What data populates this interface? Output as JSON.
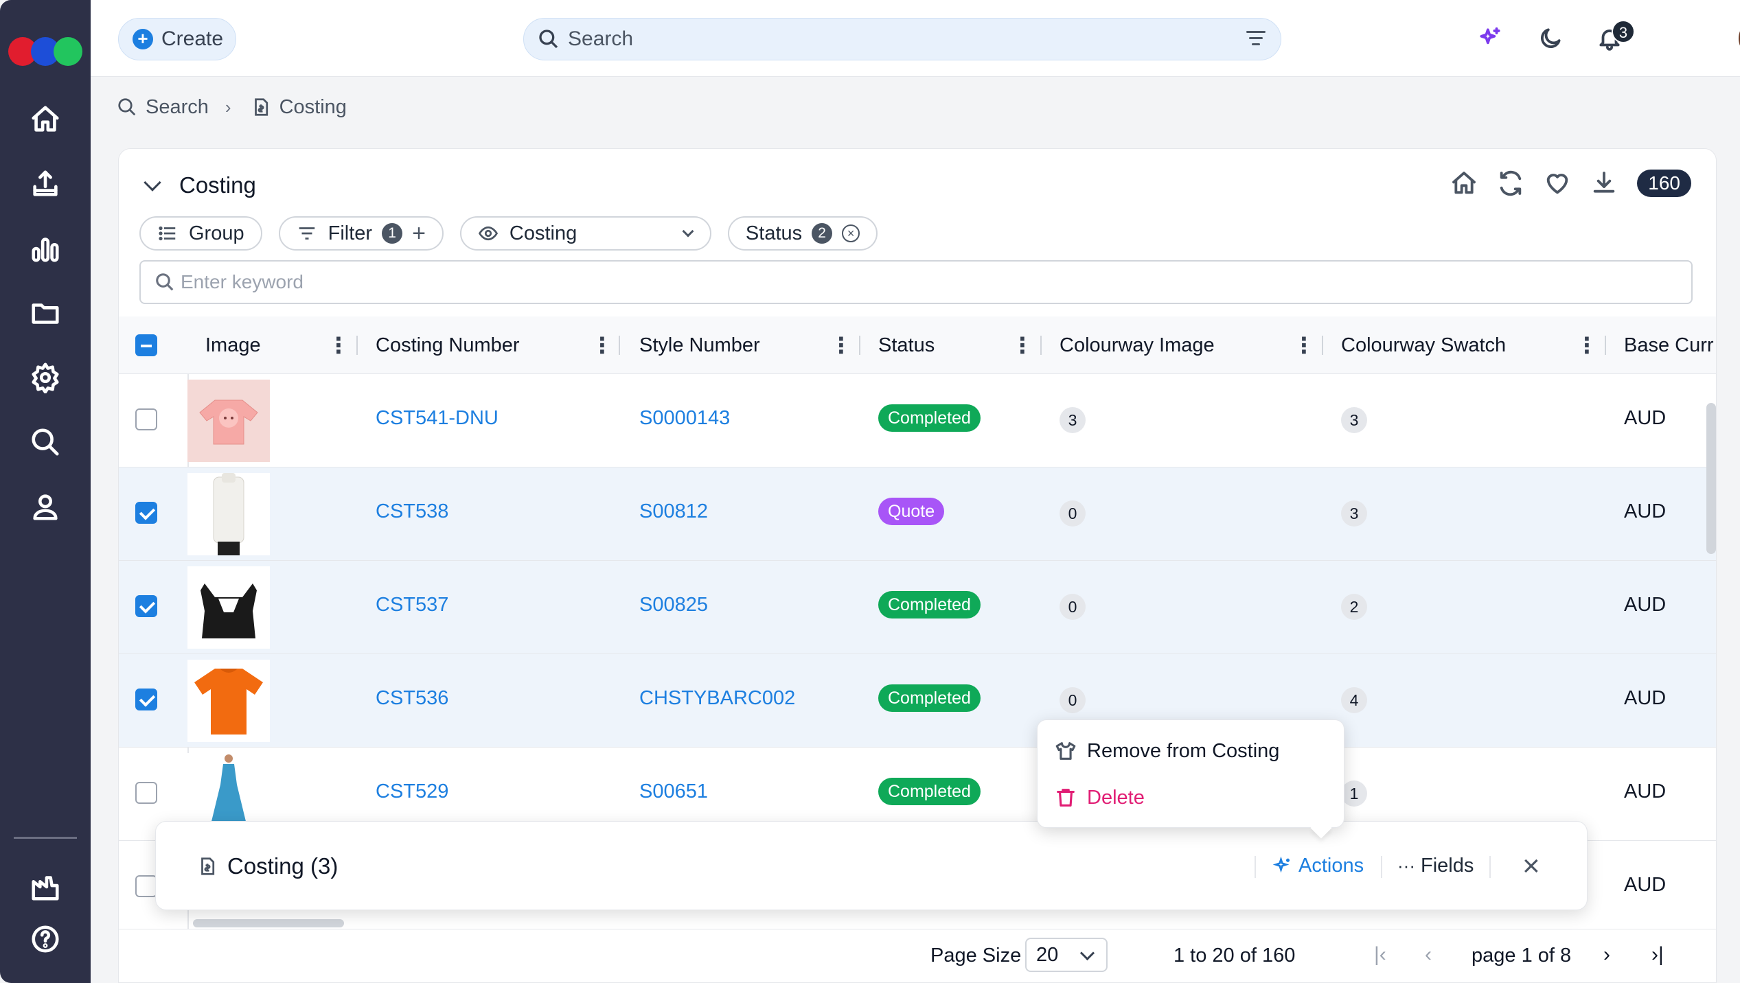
{
  "app": {
    "brand_colors": [
      "#e11d2e",
      "#1d4ed8",
      "#22c55e"
    ],
    "accent": "#1d7fe0"
  },
  "topbar": {
    "create_label": "Create",
    "search_placeholder": "Search",
    "notification_count": "3"
  },
  "breadcrumb": {
    "items": [
      "Search",
      "Costing"
    ]
  },
  "panel": {
    "title": "Costing",
    "total_count": "160",
    "chips": {
      "group_label": "Group",
      "filter_label": "Filter",
      "filter_count": "1",
      "view_label": "Costing",
      "status_label": "Status",
      "status_count": "2"
    },
    "keyword_placeholder": "Enter keyword"
  },
  "table": {
    "columns": [
      "Image",
      "Costing Number",
      "Style Number",
      "Status",
      "Colourway Image",
      "Colourway Swatch",
      "Base Curr"
    ],
    "rows": [
      {
        "costing": "CST541-DNU",
        "style": "S0000143",
        "status": "Completed",
        "cw_image": "3",
        "cw_swatch": "3",
        "currency": "AUD",
        "selected": false,
        "image": "pink-onesie"
      },
      {
        "costing": "CST538",
        "style": "S00812",
        "status": "Quote",
        "cw_image": "0",
        "cw_swatch": "3",
        "currency": "AUD",
        "selected": true,
        "image": "white-sweater"
      },
      {
        "costing": "CST537",
        "style": "S00825",
        "status": "Completed",
        "cw_image": "0",
        "cw_swatch": "2",
        "currency": "AUD",
        "selected": true,
        "image": "black-crop-top"
      },
      {
        "costing": "CST536",
        "style": "CHSTYBARC002",
        "status": "Completed",
        "cw_image": "0",
        "cw_swatch": "4",
        "currency": "AUD",
        "selected": true,
        "image": "orange-tshirt"
      },
      {
        "costing": "CST529",
        "style": "S00651",
        "status": "Completed",
        "cw_image": "",
        "cw_swatch": "1",
        "currency": "AUD",
        "selected": false,
        "image": "blue-dress"
      },
      {
        "costing": "",
        "style": "",
        "status": "",
        "cw_image": "",
        "cw_swatch": "",
        "currency": "AUD",
        "selected": false,
        "image": "black-item"
      }
    ],
    "status_colors": {
      "Completed": "#0fa958",
      "Quote": "#a855f7"
    }
  },
  "pagination": {
    "page_size_label": "Page Size",
    "page_size": "20",
    "range": "1 to 20 of 160",
    "page": "page 1 of 8"
  },
  "bulkbar": {
    "title": "Costing (3)",
    "actions_label": "Actions",
    "fields_label": "Fields"
  },
  "actions_menu": {
    "remove_label": "Remove from Costing",
    "delete_label": "Delete"
  }
}
